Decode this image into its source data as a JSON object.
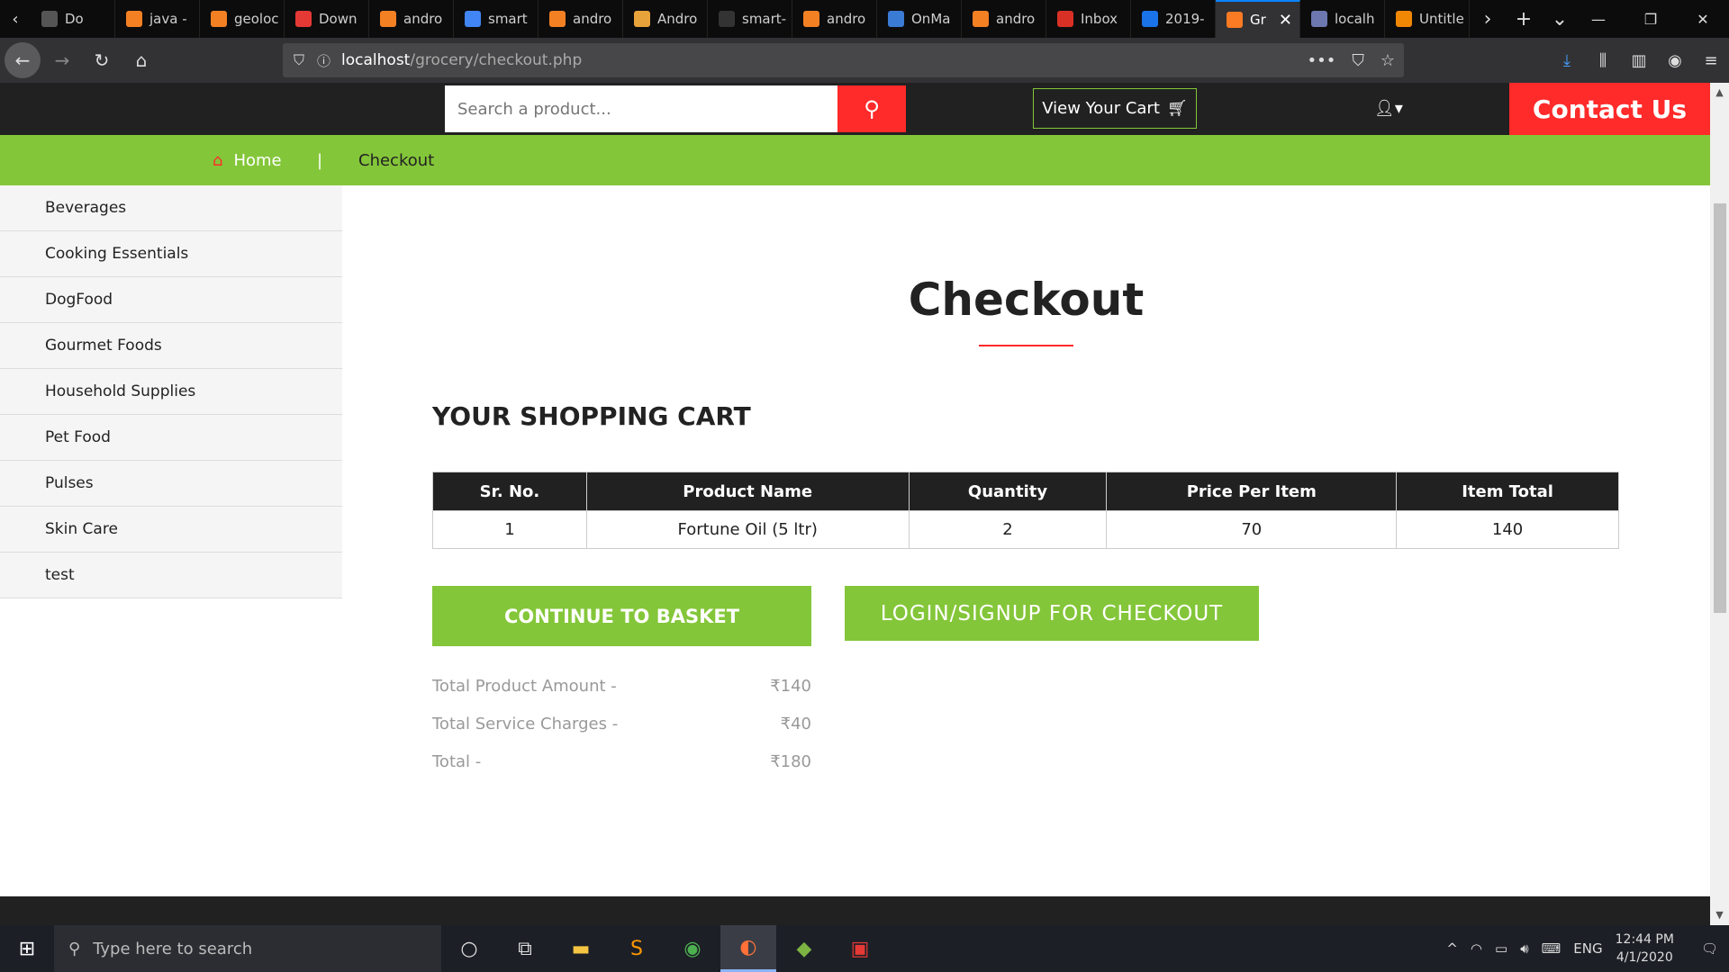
{
  "browser": {
    "tabs": [
      {
        "label": "Do",
        "icon": "tab-scroll-left-icon"
      },
      {
        "label": "java -",
        "icon": "stackoverflow-icon"
      },
      {
        "label": "geoloc",
        "icon": "stackoverflow-icon"
      },
      {
        "label": "Down",
        "icon": "download-site-icon"
      },
      {
        "label": "andro",
        "icon": "stackoverflow-icon"
      },
      {
        "label": "smart",
        "icon": "google-icon"
      },
      {
        "label": "andro",
        "icon": "stackoverflow-icon"
      },
      {
        "label": "Andro",
        "icon": "java-icon"
      },
      {
        "label": "smart-",
        "icon": "github-icon"
      },
      {
        "label": "andro",
        "icon": "stackoverflow-icon"
      },
      {
        "label": "OnMa",
        "icon": "map-icon"
      },
      {
        "label": "andro",
        "icon": "stackoverflow-icon"
      },
      {
        "label": "Inbox",
        "icon": "gmail-icon"
      },
      {
        "label": "2019-",
        "icon": "contacts-icon"
      },
      {
        "label": "Gr",
        "icon": "xampp-icon",
        "active": true
      },
      {
        "label": "localh",
        "icon": "phpmyadmin-icon"
      },
      {
        "label": "Untitle",
        "icon": "draw-icon"
      }
    ],
    "url_host": "localhost",
    "url_path": "/grocery/checkout.php"
  },
  "header": {
    "search_placeholder": "Search a product...",
    "view_cart_label": "View Your Cart",
    "contact_label": "Contact Us"
  },
  "breadcrumb": {
    "home": "Home",
    "separator": "|",
    "current": "Checkout"
  },
  "sidebar": {
    "items": [
      "Beverages",
      "Cooking Essentials",
      "DogFood",
      "Gourmet Foods",
      "Household Supplies",
      "Pet Food",
      "Pulses",
      "Skin Care",
      "test"
    ]
  },
  "main": {
    "title": "Checkout",
    "cart_heading": "YOUR SHOPPING CART",
    "table": {
      "headers": [
        "Sr. No.",
        "Product Name",
        "Quantity",
        "Price Per Item",
        "Item Total"
      ],
      "rows": [
        [
          "1",
          "Fortune Oil (5 ltr)",
          "2",
          "70",
          "140"
        ]
      ]
    },
    "continue_label": "CONTINUE TO BASKET",
    "login_label": "LOGIN/SIGNUP FOR CHECKOUT",
    "totals": [
      {
        "label": "Total Product Amount -",
        "value": "₹140"
      },
      {
        "label": "Total Service Charges -",
        "value": "₹40"
      },
      {
        "label": "Total -",
        "value": "₹180"
      }
    ]
  },
  "taskbar": {
    "search_placeholder": "Type here to search",
    "language": "ENG",
    "time": "12:44 PM",
    "date": "4/1/2020"
  },
  "colors": {
    "accent_green": "#84c639",
    "accent_red": "#ff2a2a",
    "dark": "#212121"
  }
}
